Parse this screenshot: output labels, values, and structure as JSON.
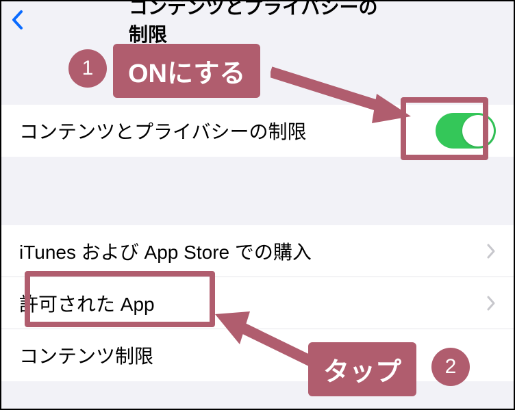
{
  "header": {
    "title": "コンテンツとプライバシーの制限"
  },
  "section1": {
    "row1_label": "コンテンツとプライバシーの制限",
    "toggle_on": true
  },
  "section2": {
    "row1_label": "iTunes および App Store での購入",
    "row2_label": "許可された App",
    "row3_label": "コンテンツ制限"
  },
  "annotations": {
    "badge1": "1",
    "badge2": "2",
    "callout1": "ONにする",
    "callout2": "タップ",
    "accent": "#b05d6e"
  }
}
